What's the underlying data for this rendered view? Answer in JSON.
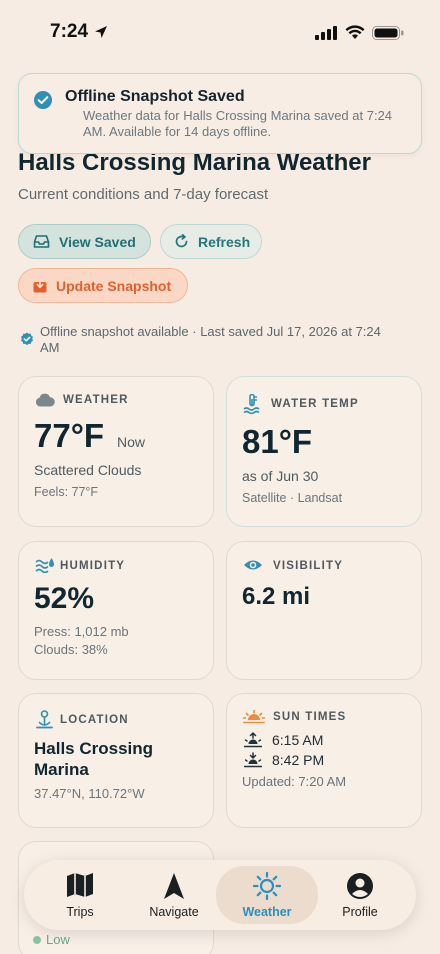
{
  "status_bar": {
    "time": "7:24"
  },
  "toast": {
    "title": "Offline Snapshot Saved",
    "message": "Weather data for Halls Crossing Marina saved at 7:24 AM. Available for 14 days offline."
  },
  "header": {
    "title": "Halls Crossing Marina Weather",
    "subtitle": "Current conditions and 7-day forecast"
  },
  "actions": {
    "view_saved": "View Saved",
    "refresh": "Refresh",
    "update_snapshot": "Update Snapshot"
  },
  "offline_note": "Offline snapshot available · Last saved Jul 17, 2026 at 7:24 AM",
  "cards": {
    "weather": {
      "label": "WEATHER",
      "temp": "77°F",
      "now": "Now",
      "condition": "Scattered Clouds",
      "feels": "Feels: 77°F"
    },
    "water_temp": {
      "label": "WATER TEMP",
      "temp": "81°F",
      "as_of": "as of Jun 30",
      "source": "Satellite · Landsat"
    },
    "humidity": {
      "label": "HUMIDITY",
      "value": "52%",
      "pressure": "Press: 1,012 mb",
      "clouds": "Clouds: 38%"
    },
    "visibility": {
      "label": "VISIBILITY",
      "value": "6.2 mi"
    },
    "location": {
      "label": "LOCATION",
      "name": "Halls Crossing Marina",
      "coords": "37.47°N, 110.72°W"
    },
    "sun_times": {
      "label": "SUN TIMES",
      "sunrise": "6:15 AM",
      "sunset": "8:42 PM",
      "updated": "Updated: 7:20 AM"
    },
    "peek": {
      "text": "Low"
    }
  },
  "nav": {
    "items": [
      {
        "label": "Trips",
        "icon": "map-icon"
      },
      {
        "label": "Navigate",
        "icon": "navigate-arrow-icon"
      },
      {
        "label": "Weather",
        "icon": "sun-icon",
        "active": true
      },
      {
        "label": "Profile",
        "icon": "profile-icon"
      }
    ]
  },
  "colors": {
    "accent_teal": "#1f6f73",
    "accent_orange": "#e4602b",
    "active_blue": "#2b8fc2",
    "background": "#f7ece3"
  }
}
